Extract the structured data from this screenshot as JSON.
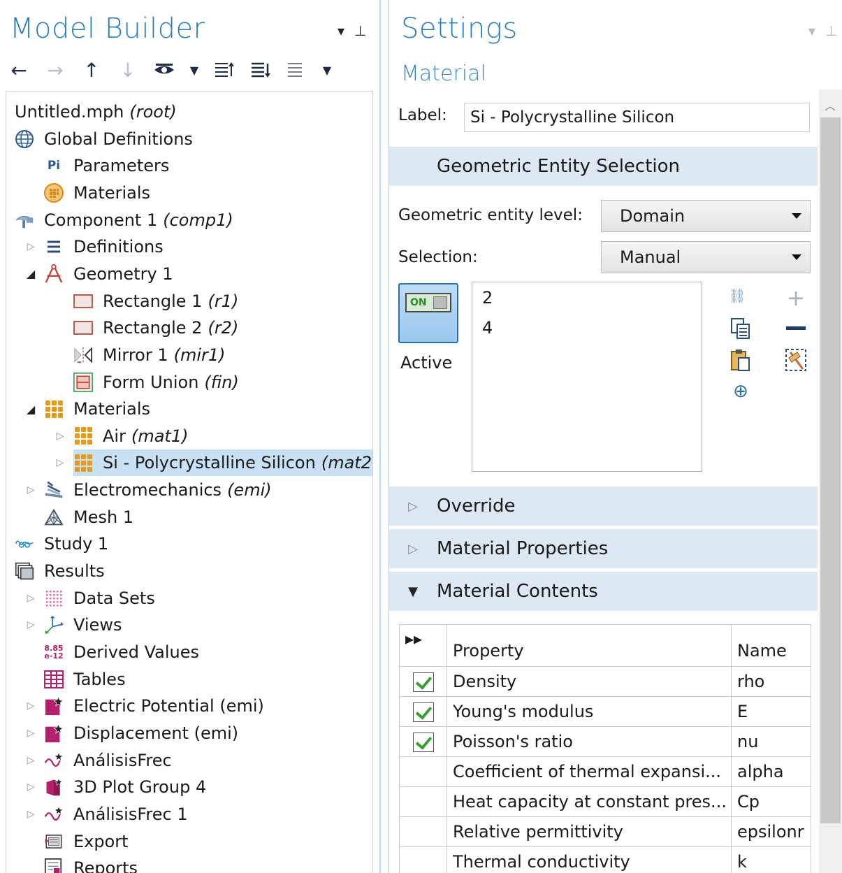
{
  "model_builder": {
    "title": "Model Builder",
    "toolbar": [
      "arrow-left",
      "arrow-right",
      "arrow-up",
      "arrow-down",
      "show-more",
      "dropdown",
      "collapse-all",
      "expand-all",
      "move",
      "dropdown"
    ],
    "tree": [
      {
        "id": "root",
        "label": "Untitled.mph",
        "tag": "(root)"
      },
      {
        "id": "global-definitions",
        "label": "Global Definitions",
        "icon": "globe-icon"
      },
      {
        "id": "parameters",
        "label": "Parameters",
        "icon": "pi-icon",
        "icon_text": "Pi"
      },
      {
        "id": "materials-global",
        "label": "Materials",
        "icon": "material-circle-icon"
      },
      {
        "id": "component-1",
        "label": "Component 1",
        "tag": "(comp1)",
        "icon": "component-icon"
      },
      {
        "id": "definitions",
        "label": "Definitions",
        "icon": "list-icon"
      },
      {
        "id": "geometry-1",
        "label": "Geometry 1",
        "icon": "geometry-icon"
      },
      {
        "id": "rectangle-1",
        "label": "Rectangle 1",
        "tag": "(r1)",
        "icon": "rectangle-icon"
      },
      {
        "id": "rectangle-2",
        "label": "Rectangle 2",
        "tag": "(r2)",
        "icon": "rectangle-icon"
      },
      {
        "id": "mirror-1",
        "label": "Mirror 1",
        "tag": "(mir1)",
        "icon": "mirror-icon"
      },
      {
        "id": "form-union",
        "label": "Form Union",
        "tag": "(fin)",
        "icon": "form-union-icon"
      },
      {
        "id": "materials",
        "label": "Materials",
        "icon": "material-icon"
      },
      {
        "id": "air",
        "label": "Air",
        "tag": "(mat1)",
        "icon": "material-icon"
      },
      {
        "id": "si-polycrystalline",
        "label": "Si - Polycrystalline Silicon",
        "tag": "(mat2",
        "icon": "material-icon"
      },
      {
        "id": "electromechanics",
        "label": "Electromechanics",
        "tag": "(emi)",
        "icon": "physics-icon"
      },
      {
        "id": "mesh-1",
        "label": "Mesh 1",
        "icon": "mesh-icon"
      },
      {
        "id": "study-1",
        "label": "Study 1",
        "icon": "study-icon"
      },
      {
        "id": "results",
        "label": "Results",
        "icon": "results-icon"
      },
      {
        "id": "data-sets",
        "label": "Data Sets",
        "icon": "data-sets-icon"
      },
      {
        "id": "views",
        "label": "Views",
        "icon": "views-icon"
      },
      {
        "id": "derived-values",
        "label": "Derived Values",
        "icon": "derived-values-icon",
        "icon_text": "8.85 e-12"
      },
      {
        "id": "tables",
        "label": "Tables",
        "icon": "table-icon"
      },
      {
        "id": "electric-potential",
        "label": "Electric Potential (emi)",
        "icon": "plot-group-icon"
      },
      {
        "id": "displacement",
        "label": "Displacement (emi)",
        "icon": "plot-group-icon"
      },
      {
        "id": "analisis-frec",
        "label": "AnálisisFrec",
        "icon": "plot-1d-icon"
      },
      {
        "id": "3d-plot-group-4",
        "label": "3D Plot Group 4",
        "icon": "plot-3d-icon"
      },
      {
        "id": "analisis-frec-1",
        "label": "AnálisisFrec 1",
        "icon": "plot-1d-icon"
      },
      {
        "id": "export",
        "label": "Export",
        "icon": "export-icon"
      },
      {
        "id": "reports",
        "label": "Reports",
        "icon": "reports-icon"
      }
    ]
  },
  "settings": {
    "title": "Settings",
    "subtitle": "Material",
    "label_caption": "Label:",
    "label_value": "Si - Polycrystalline Silicon",
    "geometric_entity_section": "Geometric Entity Selection",
    "entity_level_caption": "Geometric entity level:",
    "entity_level_value": "Domain",
    "selection_caption": "Selection:",
    "selection_value": "Manual",
    "active_toggle": "ON",
    "active_label": "Active",
    "selection_list": [
      "2",
      "4"
    ],
    "sections": {
      "override": "Override",
      "material_properties": "Material Properties",
      "material_contents": "Material Contents"
    },
    "table": {
      "headers": [
        "Property",
        "Name"
      ],
      "rows": [
        {
          "checked": true,
          "property": "Density",
          "name": "rho"
        },
        {
          "checked": true,
          "property": "Young's modulus",
          "name": "E"
        },
        {
          "checked": true,
          "property": "Poisson's ratio",
          "name": "nu"
        },
        {
          "checked": false,
          "property": "Coefficient of thermal expansi...",
          "name": "alpha"
        },
        {
          "checked": false,
          "property": "Heat capacity at constant pres...",
          "name": "Cp"
        },
        {
          "checked": false,
          "property": "Relative permittivity",
          "name": "epsilonr"
        },
        {
          "checked": false,
          "property": "Thermal conductivity",
          "name": "k"
        }
      ]
    }
  }
}
